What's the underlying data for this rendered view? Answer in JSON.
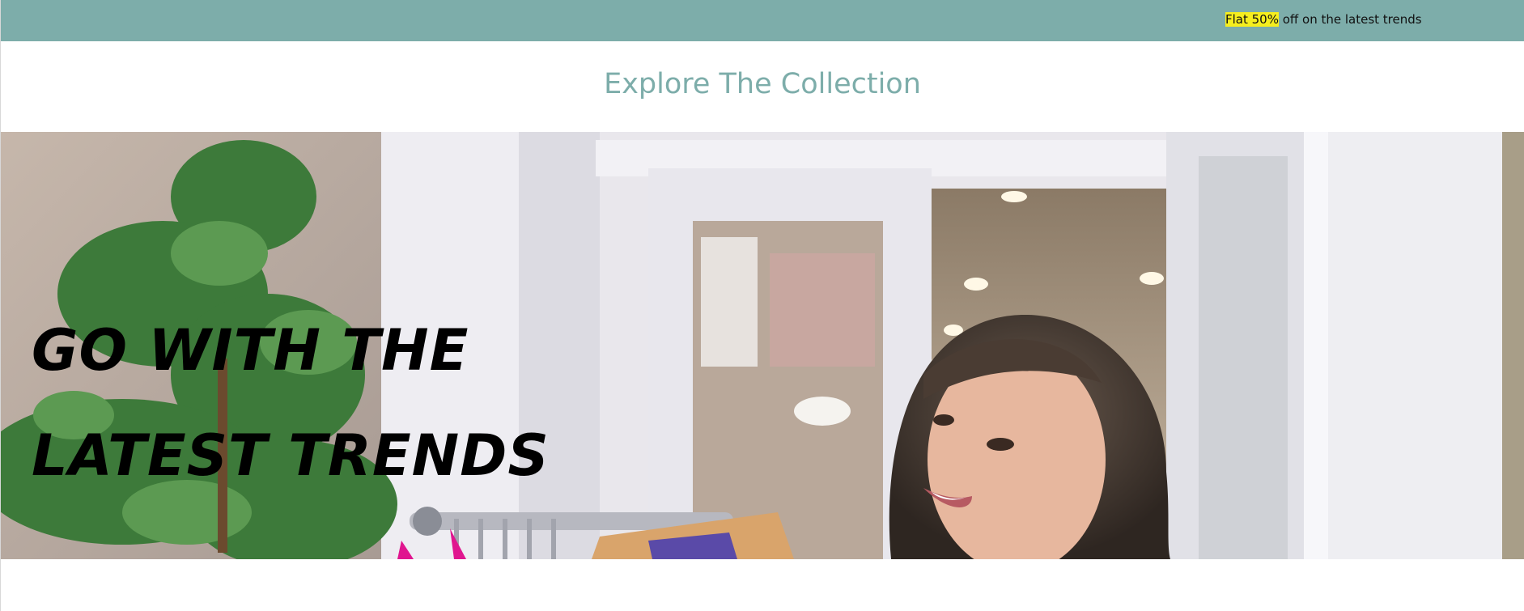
{
  "promo": {
    "highlight": "Flat 50%",
    "rest": " off on the latest trends",
    "colors": {
      "bar": "#7dadaa",
      "highlight": "#f6ee1e"
    }
  },
  "section": {
    "title": "Explore The Collection"
  },
  "hero": {
    "headline_line1": "GO WITH THE",
    "headline_line2": "LATEST TRENDS",
    "image_alt": "Woman smiling beside a clothing rack in a boutique storefront"
  }
}
